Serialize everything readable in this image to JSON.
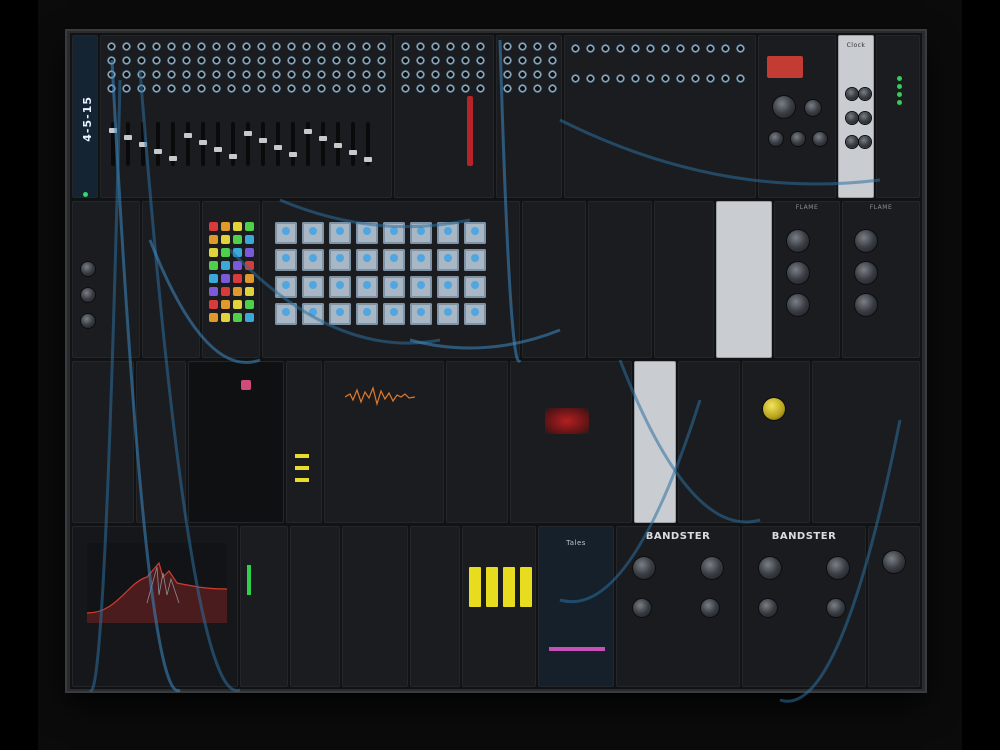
{
  "window": {
    "background": "#000000",
    "rack_background": "#111214",
    "accent_cable": "#2f7fb8"
  },
  "modules": {
    "sequencer_title": "4-5-15",
    "mixer_label": "",
    "clock_label": "Clock",
    "dual_label_a": "BANDSTER",
    "dual_label_b": "BANDSTER",
    "yellow_fader_label": "",
    "purple_label": "Tales",
    "flame_label_a": "FLAME",
    "flame_label_b": "FLAME",
    "spectrum_label": ""
  },
  "cables": {
    "color_primary": "#2b6f9f",
    "color_secondary": "#3d8bc4"
  }
}
